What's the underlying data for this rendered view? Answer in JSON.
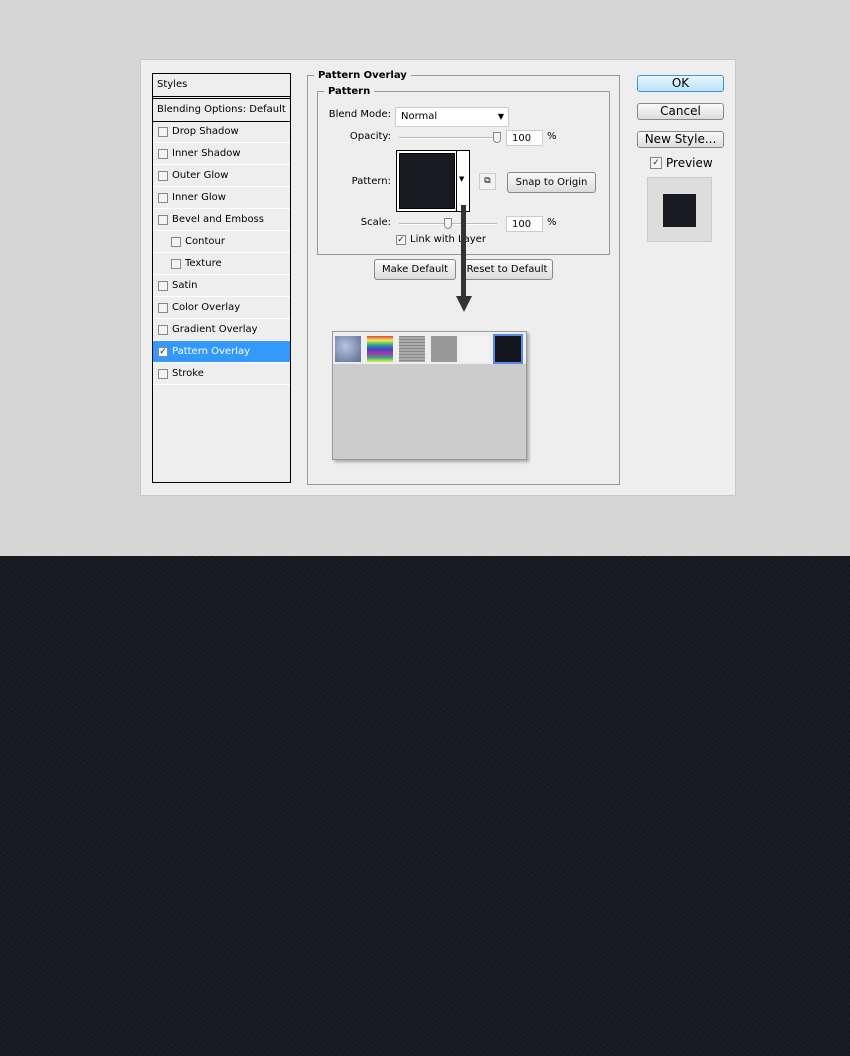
{
  "styles_panel": {
    "header": "Styles",
    "blending": "Blending Options: Default",
    "items": [
      {
        "label": "Drop Shadow",
        "checked": false,
        "sub": false
      },
      {
        "label": "Inner Shadow",
        "checked": false,
        "sub": false
      },
      {
        "label": "Outer Glow",
        "checked": false,
        "sub": false
      },
      {
        "label": "Inner Glow",
        "checked": false,
        "sub": false
      },
      {
        "label": "Bevel and Emboss",
        "checked": false,
        "sub": false
      },
      {
        "label": "Contour",
        "checked": false,
        "sub": true
      },
      {
        "label": "Texture",
        "checked": false,
        "sub": true
      },
      {
        "label": "Satin",
        "checked": false,
        "sub": false
      },
      {
        "label": "Color Overlay",
        "checked": false,
        "sub": false
      },
      {
        "label": "Gradient Overlay",
        "checked": false,
        "sub": false
      },
      {
        "label": "Pattern Overlay",
        "checked": true,
        "sub": false,
        "selected": true
      },
      {
        "label": "Stroke",
        "checked": false,
        "sub": false
      }
    ]
  },
  "main": {
    "group": "Pattern Overlay",
    "subgroup": "Pattern",
    "blend_label": "Blend Mode:",
    "blend_value": "Normal",
    "opacity_label": "Opacity:",
    "opacity_value": "100",
    "percent": "%",
    "pattern_label": "Pattern:",
    "snap": "Snap to Origin",
    "scale_label": "Scale:",
    "scale_value": "100",
    "link_label": "Link with Layer",
    "link_checked": true,
    "make_default": "Make Default",
    "reset_default": "Reset to Default"
  },
  "buttons": {
    "ok": "OK",
    "cancel": "Cancel",
    "new_style": "New Style...",
    "preview": "Preview"
  },
  "colors": {
    "selection": "#3399ff",
    "pattern": "#1a1b20"
  }
}
